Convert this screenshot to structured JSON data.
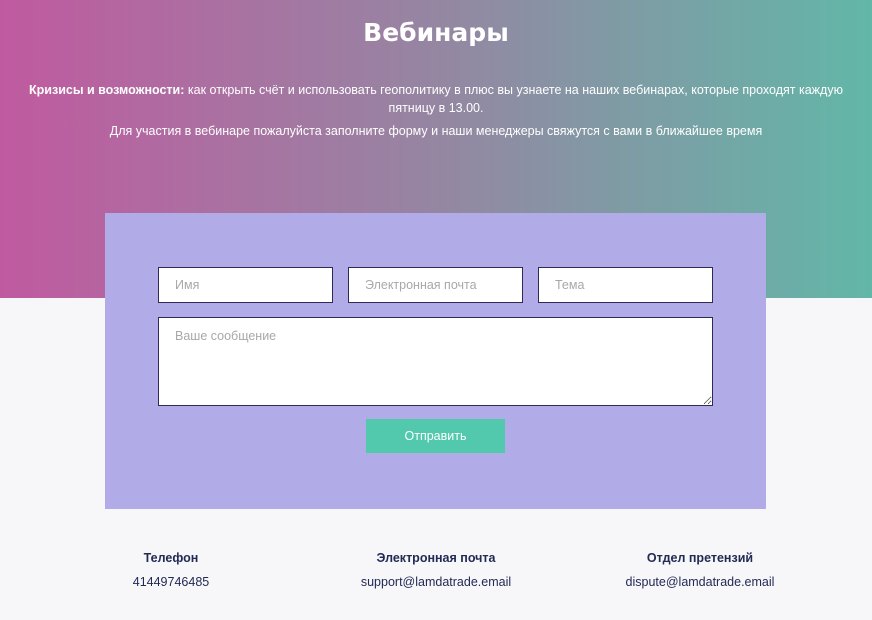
{
  "hero": {
    "title": "Вебинары",
    "lead_bold": "Кризисы и возможности:",
    "lead_text": " как открыть счёт и использовать геополитику в плюс вы узнаете на наших вебинарах, которые проходят каждую пятницу в 13.00.",
    "note": "Для участия в вебинаре пожалуйста заполните форму и наши менеджеры свяжутся с вами в ближайшее время"
  },
  "form": {
    "name_placeholder": "Имя",
    "email_placeholder": "Электронная почта",
    "subject_placeholder": "Тема",
    "message_placeholder": "Ваше сообщение",
    "submit_label": "Отправить"
  },
  "contacts": {
    "phone": {
      "label": "Телефон",
      "value": "41449746485"
    },
    "email": {
      "label": "Электронная почта",
      "value": "support@lamdatrade.email"
    },
    "claims": {
      "label": "Отдел претензий",
      "value": "dispute@lamdatrade.email"
    }
  },
  "colors": {
    "gradient_start": "#c05aa0",
    "gradient_end": "#62b7a8",
    "form_background": "#b1ace8",
    "button": "#52c9ad",
    "footer_text": "#222a55"
  }
}
